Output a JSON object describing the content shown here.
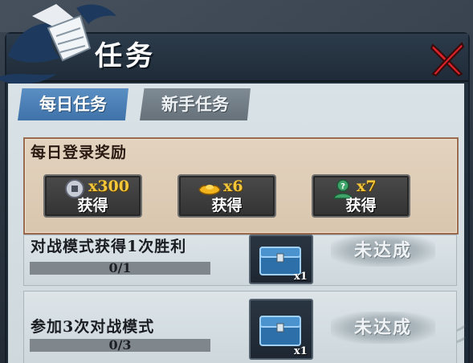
{
  "header": {
    "title": "任务"
  },
  "tabs": [
    {
      "label": "每日任务",
      "active": true
    },
    {
      "label": "新手任务",
      "active": false
    }
  ],
  "login_reward": {
    "title": "每日登录奖励",
    "items": [
      {
        "amount": "x300",
        "label": "获得",
        "icon": "coin-icon"
      },
      {
        "amount": "x6",
        "label": "获得",
        "icon": "gold-ingot-icon"
      },
      {
        "amount": "x7",
        "label": "获得",
        "icon": "mystery-avatar-icon"
      }
    ]
  },
  "tasks": [
    {
      "name": "对战模式获得1次胜利",
      "progress": "0/1",
      "progress_fraction": 0,
      "reward_qty": "x1",
      "status": "未达成"
    },
    {
      "name": "参加3次对战模式",
      "progress": "0/3",
      "progress_fraction": 0,
      "reward_qty": "x1",
      "status": "未达成"
    }
  ],
  "colors": {
    "active_tab": "#4a80b8",
    "inactive_tab": "#727e87",
    "reward_amount": "#f4c63a",
    "close_red": "#d8232a"
  }
}
